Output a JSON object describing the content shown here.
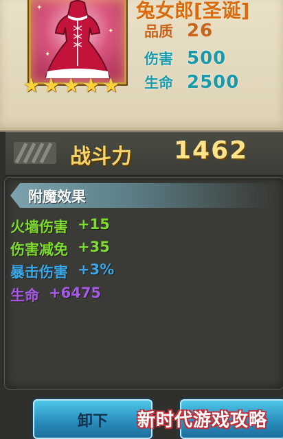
{
  "item": {
    "name": "兔女郎[圣诞]",
    "stars": 5,
    "stats": [
      {
        "label": "品质",
        "value": "26"
      },
      {
        "label": "伤害",
        "value": "500"
      },
      {
        "label": "生命",
        "value": "2500"
      }
    ]
  },
  "power": {
    "label": "战斗力",
    "value": "1462"
  },
  "enchant": {
    "title": "附魔效果",
    "effects": [
      {
        "name": "火墙伤害",
        "value": "+15",
        "color": "#7fdc2e"
      },
      {
        "name": "伤害减免",
        "value": "+35",
        "color": "#7fdc2e"
      },
      {
        "name": "暴击伤害",
        "value": "+3%",
        "color": "#3aa6e6"
      },
      {
        "name": "生命",
        "value": "+6475",
        "color": "#a65ae6"
      }
    ]
  },
  "buttons": {
    "unequip_label": "卸下"
  },
  "watermark": "新时代游戏攻略",
  "icons": {
    "portrait": "christmas-dress-icon",
    "star": "star-icon",
    "power": "stripe-icon"
  }
}
